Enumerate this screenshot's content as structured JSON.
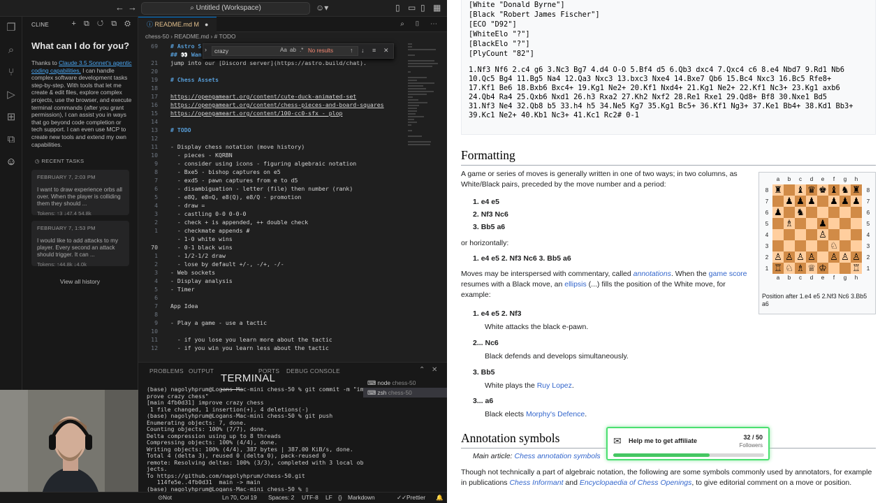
{
  "titlebar": {
    "title": "Untitled (Workspace)"
  },
  "sidebar": {
    "header": "CLINE",
    "question": "What can I do for you?",
    "intro_pre": "Thanks to ",
    "intro_link": "Claude 3.5 Sonnet's agentic coding capabilities,",
    "intro_post": " I can handle complex software development tasks step-by-step. With tools that let me create & edit files, explore complex projects, use the browser, and execute terminal commands (after you grant permission), I can assist you in ways that go beyond code completion or tech support. I can even use MCP to create new tools and extend my own capabilities.",
    "recent_label": "RECENT TASKS",
    "tasks": [
      {
        "date": "FEBRUARY 7, 2:03 PM",
        "text": "I want to draw experience orbs all over. When the player is colliding them they should ...",
        "tokens": "Tokens: ↑3 ↓47.4 54.8k"
      },
      {
        "date": "FEBRUARY 7, 1:53 PM",
        "text": "I would like to add attacks to my player. Every second an attack should trigger. It can ...",
        "tokens": "Tokens: ↑44.8k ↓4.0k"
      }
    ],
    "view_all": "View all history"
  },
  "editor": {
    "tab": "README.md",
    "tab_mod": "M",
    "breadcrumb": "chess-50 › README.md › # TODO",
    "find": {
      "query": "crazy",
      "results": "No results"
    },
    "lines": [
      {
        "n": "69",
        "t": "# Astro S"
      },
      {
        "n": "",
        "t": "## 👀 Wan"
      },
      {
        "n": "21",
        "t": "jump into our [Discord server](https://astro.build/chat)."
      },
      {
        "n": "20",
        "t": ""
      },
      {
        "n": "19",
        "t": "# Chess Assets"
      },
      {
        "n": "18",
        "t": ""
      },
      {
        "n": "17",
        "t": "https://opengameart.org/content/cute-duck-animated-set"
      },
      {
        "n": "16",
        "t": "https://opengameart.org/content/chess-pieces-and-board-squares"
      },
      {
        "n": "15",
        "t": "https://opengameart.org/content/100-cc0-sfx - plop"
      },
      {
        "n": "14",
        "t": ""
      },
      {
        "n": "13",
        "t": "# TODO"
      },
      {
        "n": "12",
        "t": ""
      },
      {
        "n": "11",
        "t": "- Display chess notation (move history)"
      },
      {
        "n": "10",
        "t": "  - pieces - KQRBN"
      },
      {
        "n": "9",
        "t": "  - consider using icons - figuring algebraic notation"
      },
      {
        "n": "8",
        "t": "  - Bxe5 - bishop captures on e5"
      },
      {
        "n": "7",
        "t": "  - exd5 - pawn captures from e to d5"
      },
      {
        "n": "6",
        "t": "  - disambiguation - letter (file) then number (rank)"
      },
      {
        "n": "5",
        "t": "  - e8Q, e8=Q, e8(Q), e8/Q - promotion"
      },
      {
        "n": "4",
        "t": "  - draw ="
      },
      {
        "n": "3",
        "t": "  - castling 0-0 0-0-0"
      },
      {
        "n": "2",
        "t": "  - check + is appended, ++ double check"
      },
      {
        "n": "1",
        "t": "  - checkmate appends #"
      },
      {
        "n": "",
        "t": "  - 1-0 white wins"
      },
      {
        "n": "70",
        "t": "  - 0-1 black wins"
      },
      {
        "n": "1",
        "t": "  - 1/2-1/2 draw"
      },
      {
        "n": "2",
        "t": "  - lose by default +/-, -/+, -/-"
      },
      {
        "n": "3",
        "t": "- Web sockets"
      },
      {
        "n": "4",
        "t": "- Display analysis"
      },
      {
        "n": "5",
        "t": "- Timer"
      },
      {
        "n": "6",
        "t": ""
      },
      {
        "n": "7",
        "t": "App Idea"
      },
      {
        "n": "8",
        "t": ""
      },
      {
        "n": "9",
        "t": "- Play a game - use a tactic"
      },
      {
        "n": "10",
        "t": ""
      },
      {
        "n": "11",
        "t": "  - if you lose you learn more about the tactic"
      },
      {
        "n": "12",
        "t": "  - if you win you learn less about the tactic"
      }
    ]
  },
  "panel": {
    "tabs": [
      "PROBLEMS",
      "OUTPUT",
      "TERMINAL",
      "PORTS",
      "DEBUG CONSOLE"
    ],
    "terminal": "(base) nagolyhprum@Logans-Mac-mini chess-50 % git commit -m \"im\nprove crazy chess\"\n[main 4fb0d31] improve crazy chess\n 1 file changed, 1 insertion(+), 4 deletions(-)\n(base) nagolyhprum@Logans-Mac-mini chess-50 % git push\nEnumerating objects: 7, done.\nCounting objects: 100% (7/7), done.\nDelta compression using up to 8 threads\nCompressing objects: 100% (4/4), done.\nWriting objects: 100% (4/4), 387 bytes | 387.00 KiB/s, done.\nTotal 4 (delta 3), reused 0 (delta 0), pack-reused 0\nremote: Resolving deltas: 100% (3/3), completed with 3 local ob\njects.\nTo https://github.com/nagolyhprum/chess-50.git\n   114fe5e..4fb0d31  main -> main\n(base) nagolyhprum@Logans-Mac-mini chess-50 % ▯",
    "terms": [
      {
        "name": "node",
        "dir": "chess-50"
      },
      {
        "name": "zsh",
        "dir": "chess-50"
      }
    ]
  },
  "status": {
    "git": "Not Committed Yet",
    "pos": "Ln 70, Col 19",
    "spaces": "Spaces: 2",
    "enc": "UTF-8",
    "eol": "LF",
    "braces": "{}",
    "lang": "Markdown",
    "prettier": "Prettier"
  },
  "wiki": {
    "pgn_tags": [
      {
        "k": "[White ",
        "v": "\"Donald Byrne\"]"
      },
      {
        "k": "[Black ",
        "v": "\"Robert James Fischer\"]"
      },
      {
        "k": "[ECO ",
        "v": "\"D92\"]"
      },
      {
        "k": "[WhiteElo ",
        "v": "\"?\"]"
      },
      {
        "k": "[BlackElo ",
        "v": "\"?\"]"
      },
      {
        "k": "[PlyCount ",
        "v": "\"82\"]"
      }
    ],
    "pgn_moves": "1.Nf3 Nf6 2.c4 g6 3.Nc3 Bg7 4.d4 O-O 5.Bf4 d5 6.Qb3 dxc4 7.Qxc4 c6 8.e4 Nbd7 9.Rd1 Nb6\n10.Qc5 Bg4 11.Bg5 Na4 12.Qa3 Nxc3 13.bxc3 Nxe4 14.Bxe7 Qb6 15.Bc4 Nxc3 16.Bc5 Rfe8+\n17.Kf1 Be6 18.Bxb6 Bxc4+ 19.Kg1 Ne2+ 20.Kf1 Nxd4+ 21.Kg1 Ne2+ 22.Kf1 Nc3+ 23.Kg1 axb6\n24.Qb4 Ra4 25.Qxb6 Nxd1 26.h3 Rxa2 27.Kh2 Nxf2 28.Re1 Rxe1 29.Qd8+ Bf8 30.Nxe1 Bd5\n31.Nf3 Ne4 32.Qb8 b5 33.h4 h5 34.Ne5 Kg7 35.Kg1 Bc5+ 36.Kf1 Ng3+ 37.Ke1 Bb4+ 38.Kd1 Bb3+\n39.Kc1 Ne2+ 40.Kb1 Nc3+ 41.Kc1 Rc2# 0-1",
    "formatting_h": "Formatting",
    "fmt_p": "A game or series of moves is generally written in one of two ways; in two columns, as White/Black pairs, preceded by the move number and a period:",
    "cols": [
      "e4 e5",
      "Nf3 Nc6",
      "Bb5 a6"
    ],
    "or_h": "or horizontally:",
    "horiz": "e4 e5 2. Nf3 Nc6 3. Bb5 a6",
    "comm_a": "Moves may be interspersed with commentary, called ",
    "comm_link1": "annotations",
    "comm_b": ". When the ",
    "comm_link2": "game score",
    "comm_c": " resumes with a Black move, an ",
    "comm_link3": "ellipsis",
    "comm_d": " (...) fills the position of the White move, for example:",
    "ex": [
      {
        "m": "1. e4 e5 2. Nf3",
        "c": "White attacks the black e-pawn.",
        "link": ""
      },
      {
        "m": "2... Nc6",
        "c": "Black defends and develops simultaneously.",
        "link": ""
      },
      {
        "m": "3. Bb5",
        "c": "White plays the ",
        "link": "Ruy Lopez"
      },
      {
        "m": "3... a6",
        "c": "Black elects ",
        "link": "Morphy's Defence"
      }
    ],
    "ann_h": "Annotation symbols",
    "main_art": "Main article: ",
    "main_link": "Chess annotation symbols",
    "last_a": "Though not technically a part of algebraic notation, the following are some symbols commonly used by annotators, for example in publications ",
    "last_l1": "Chess Informant",
    "last_b": " and ",
    "last_l2": "Encyclopaedia of Chess Openings",
    "last_c": ", to give editorial comment on a move or position.",
    "board_files": [
      "a",
      "b",
      "c",
      "d",
      "e",
      "f",
      "g",
      "h"
    ],
    "board_ranks": [
      "8",
      "7",
      "6",
      "5",
      "4",
      "3",
      "2",
      "1"
    ],
    "board": [
      "♜ ♝♛♚♝♞♜",
      " ♟♟♟ ♟♟♟",
      "♟ ♞     ",
      " ♗  ♟   ",
      "    ♙   ",
      "     ♘  ",
      "♙♙♙♙ ♙♙♙",
      "♖♘♗♕♔  ♖"
    ],
    "board_caption": "Position after 1.e4 e5 2.Nf3 Nc6 3.Bb5 a6"
  },
  "affiliate": {
    "title": "Help me to get affiliate",
    "count": "32 / 50",
    "followers": "Followers",
    "progress": 0.64
  }
}
